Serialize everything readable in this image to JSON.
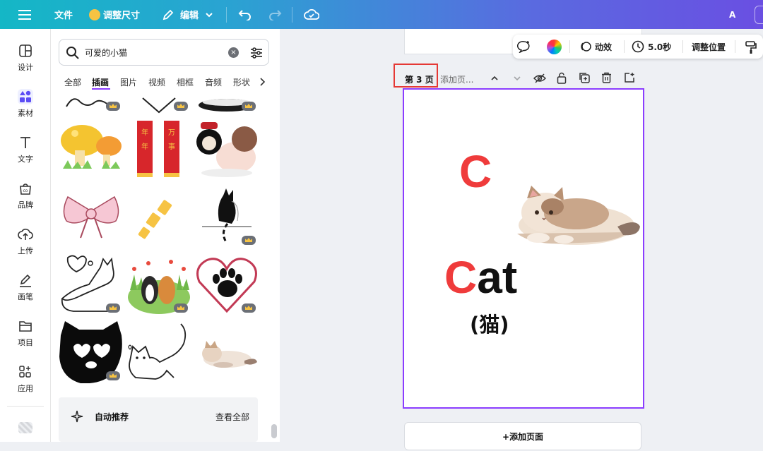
{
  "topbar": {
    "menu_icon": "hamburger-icon",
    "file_label": "文件",
    "resize_label": "调整尺寸",
    "edit_label": "编辑",
    "undo_icon": "undo-icon",
    "redo_icon": "redo-icon",
    "cloud_icon": "cloud-save-icon",
    "avatar_letter": "A"
  },
  "rail": {
    "items": [
      {
        "label": "设计",
        "icon": "layout-icon"
      },
      {
        "label": "素材",
        "icon": "shapes-icon"
      },
      {
        "label": "文字",
        "icon": "text-icon"
      },
      {
        "label": "品牌",
        "icon": "brand-icon"
      },
      {
        "label": "上传",
        "icon": "upload-icon"
      },
      {
        "label": "画笔",
        "icon": "pen-icon"
      },
      {
        "label": "项目",
        "icon": "folder-icon"
      },
      {
        "label": "应用",
        "icon": "apps-icon"
      }
    ]
  },
  "panel": {
    "search": {
      "value": "可爱的小猫",
      "placeholder": ""
    },
    "tabs": [
      "全部",
      "插画",
      "图片",
      "视频",
      "相框",
      "音频",
      "形状"
    ],
    "active_tab": "插画",
    "recommend_label": "自动推荐",
    "view_all_label": "查看全部"
  },
  "toolbar": {
    "motion_label": "动效",
    "duration_label": "5.0秒",
    "position_label": "调整位置"
  },
  "page_header": {
    "page_label": "第 3 页",
    "title_placeholder": "添加页..."
  },
  "page": {
    "letter": "C",
    "word_first": "C",
    "word_rest": "at",
    "translation": "(猫)"
  },
  "add_page_label": "+添加页面",
  "colors": {
    "accent_purple": "#8b3dff",
    "letter_red": "#ef3b3b",
    "highlight_red": "#e53935"
  }
}
